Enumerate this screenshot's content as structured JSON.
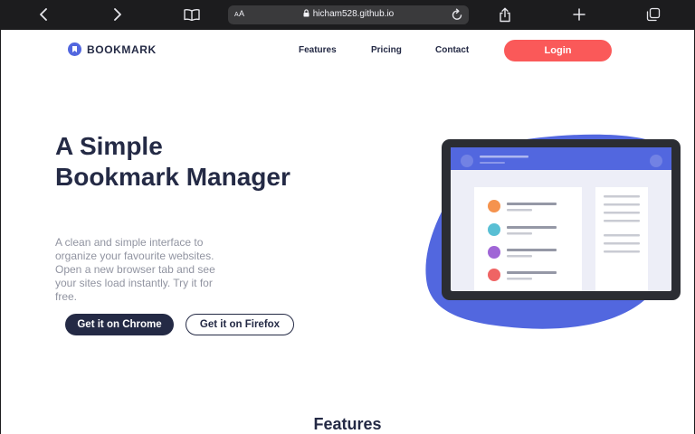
{
  "browser": {
    "url": "hicham528.github.io",
    "aa_label_small": "A",
    "aa_label_large": "A"
  },
  "site": {
    "brand": "BOOKMARK",
    "nav": {
      "features": "Features",
      "pricing": "Pricing",
      "contact": "Contact",
      "login": "Login"
    },
    "hero": {
      "title": "A Simple Bookmark Manager",
      "description": "A clean and simple interface to organize your favourite websites. Open a new browser tab and see your sites load instantly. Try it for free.",
      "primary_cta": "Get it on Chrome",
      "secondary_cta": "Get it on Firefox"
    },
    "next_section_title": "Features"
  },
  "colors": {
    "brand_blue": "#5267df",
    "brand_red": "#fa5959",
    "dark_navy": "#242a45",
    "muted_text": "#9194a1",
    "chrome_bg": "#1c1c1e"
  },
  "icons": [
    "back-icon",
    "forward-icon",
    "book-icon",
    "lock-icon",
    "reload-icon",
    "share-icon",
    "plus-icon",
    "tabs-icon",
    "bookmark-logo-icon"
  ]
}
